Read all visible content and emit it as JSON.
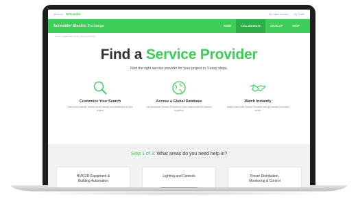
{
  "topbar": {
    "left_text": "About us",
    "logo": "Schneider",
    "right_links": [
      "My Digital Account",
      "My Profile"
    ]
  },
  "header": {
    "brand_bold": "Schneider Electric",
    "brand_rest": " Exchange",
    "nav": [
      "HOME",
      "COLLABORATE",
      "DEVELOP",
      "SHOP"
    ],
    "active_nav": "COLLABORATE"
  },
  "breadcrumb": "Home  /  Collaborate  /  Find a Service Provider",
  "hero": {
    "title_prefix": "Find a ",
    "title_highlight": "Service Provider",
    "subtitle": "Find the right service provider for your project in 3 easy steps."
  },
  "steps": [
    {
      "icon": "search-icon",
      "title": "Customize Your Search",
      "desc": "Select your specific criteria for the service and challenges of your project"
    },
    {
      "icon": "globe-icon",
      "title": "Access a Global Database",
      "desc": "Get immediate Service Providers in your location with the desired expertise"
    },
    {
      "icon": "handshake-icon",
      "title": "Match Instantly",
      "desc": "Easily match with Service Providers and get access to contact details"
    }
  ],
  "question": {
    "step_label": "Step 1 of 3:",
    "text": " What areas do you need help in?"
  },
  "areas": [
    {
      "line1": "HVAC/R Equipment &",
      "line2": "Building Automation"
    },
    {
      "line1": "Lighting and Controls",
      "line2": ""
    },
    {
      "line1": "Power Distribution,",
      "line2": "Monitoring & Control"
    }
  ],
  "colors": {
    "accent": "#3dcd58",
    "accent_dark": "#2fae47",
    "text": "#333333"
  }
}
